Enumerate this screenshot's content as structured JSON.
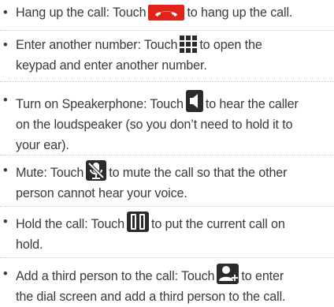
{
  "bullet": "•",
  "items": [
    {
      "icon": "hang-up-icon",
      "before": "Hang up the call: Touch",
      "after": "to hang up the call."
    },
    {
      "icon": "keypad-icon",
      "before": "Enter another number: Touch",
      "after": "to open the",
      "cont": "keypad and enter another number."
    },
    {
      "icon": "speaker-icon",
      "before": "Turn on Speakerphone: Touch",
      "after": "to hear the caller",
      "cont": "on the loudspeaker (so you don’t need to hold it to",
      "cont2": "your ear)."
    },
    {
      "icon": "mute-icon",
      "before": "Mute: Touch",
      "after": "to mute the call so that the other",
      "cont": "person cannot hear your voice."
    },
    {
      "icon": "hold-icon",
      "before": "Hold the call: Touch",
      "after": "to put the current call on",
      "cont": "hold."
    },
    {
      "icon": "add-person-icon",
      "before": "Add a third person to the call: Touch",
      "after": "to enter",
      "cont": "the dial screen and add a third person to the call."
    }
  ],
  "colors": {
    "text": "#3a3a3a",
    "hangup": "#e2231a",
    "icon_dark": "#2b2b2b",
    "divider": "#c9c9c9"
  }
}
